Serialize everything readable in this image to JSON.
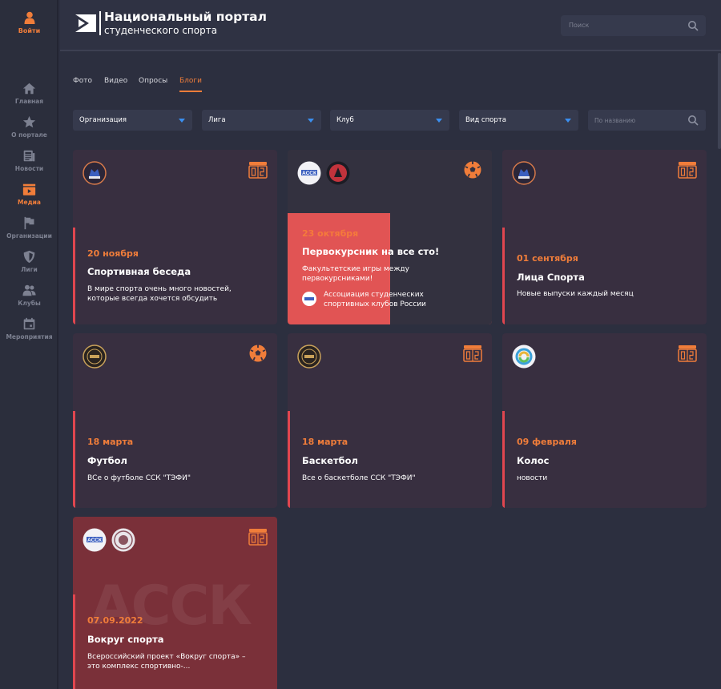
{
  "sidebar": {
    "login_label": "Войти",
    "items": [
      {
        "label": "Главная",
        "icon": "home-icon"
      },
      {
        "label": "О портале",
        "icon": "star-icon"
      },
      {
        "label": "Новости",
        "icon": "newspaper-icon"
      },
      {
        "label": "Медиа",
        "icon": "media-icon",
        "active": true
      },
      {
        "label": "Организации",
        "icon": "flag-icon"
      },
      {
        "label": "Лиги",
        "icon": "shield-icon"
      },
      {
        "label": "Клубы",
        "icon": "users-icon"
      },
      {
        "label": "Мероприятия",
        "icon": "calendar-icon"
      }
    ]
  },
  "header": {
    "title_line1": "Национальный портал",
    "title_line2": "студенческого спорта",
    "search_placeholder": "Поиск"
  },
  "tabs": [
    {
      "label": "Фото"
    },
    {
      "label": "Видео"
    },
    {
      "label": "Опросы"
    },
    {
      "label": "Блоги",
      "active": true
    }
  ],
  "filters": {
    "organization": "Организация",
    "league": "Лига",
    "club": "Клуб",
    "sport": "Вид спорта",
    "name_placeholder": "По названию"
  },
  "cards": [
    {
      "date": "20 ноября",
      "title": "Спортивная беседа",
      "desc": "В мире спорта очень много новостей, которые всегда хочется обсудить",
      "type": "scoreboard-icon"
    },
    {
      "date": "23 октября",
      "title": "Первокурсник на все сто!",
      "desc": "Факультетские игры между первокурсниками!",
      "org": "Ассоциация студенческих спортивных клубов России",
      "type": "ball-icon"
    },
    {
      "date": "01 сентября",
      "title": "Лица Спорта",
      "desc": "Новые выпуски каждый месяц",
      "type": "scoreboard-icon"
    },
    {
      "date": "18 марта",
      "title": "Футбол",
      "desc": "ВСе о футболе ССК \"ТЭФИ\"",
      "type": "ball-icon"
    },
    {
      "date": "18 марта",
      "title": "Баскетбол",
      "desc": "Все о баскетболе ССК \"ТЭФИ\"",
      "type": "scoreboard-icon"
    },
    {
      "date": "09 февраля",
      "title": "Колос",
      "desc": "новости",
      "type": "scoreboard-icon"
    },
    {
      "date": "07.09.2022",
      "title": "Вокруг спорта",
      "desc": "Всероссийский проект «Вокруг спорта» – это комплекс спортивно-...",
      "type": "scoreboard-icon"
    }
  ],
  "colors": {
    "accent_orange": "#f07d3a",
    "accent_red": "#e0464f",
    "background": "#2c2f3f"
  }
}
